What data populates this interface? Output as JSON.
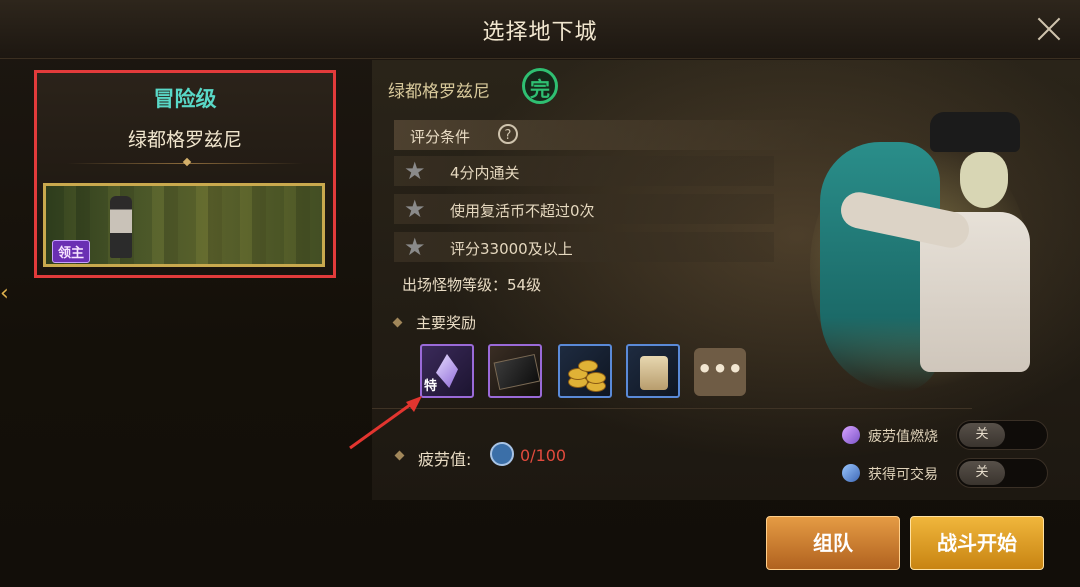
{
  "window": {
    "title": "选择地下城"
  },
  "dungeon_card": {
    "level": "冒险级",
    "name": "绿都格罗兹尼",
    "badge": "领主"
  },
  "detail": {
    "name": "绿都格罗兹尼",
    "complete_badge": "完",
    "score_header": "评分条件",
    "conditions": [
      "4分内通关",
      "使用复活币不超过0次",
      "评分33000及以上"
    ],
    "monster_level": "出场怪物等级：54级",
    "rewards_title": "主要奖励",
    "reward_items": [
      {
        "icon": "crystal-icon",
        "tag": "特"
      },
      {
        "icon": "ticket-icon"
      },
      {
        "icon": "gold-coins-icon"
      },
      {
        "icon": "scroll-icon"
      }
    ],
    "reward_more": "•••",
    "fatigue_label": "疲劳值:",
    "fatigue_value": "0/100"
  },
  "toggles": [
    {
      "label": "疲劳值燃烧",
      "state": "关"
    },
    {
      "label": "获得可交易",
      "state": "关"
    }
  ],
  "buttons": {
    "team": "组队",
    "fight": "战斗开始"
  },
  "colors": {
    "accent_teal": "#59d8c7",
    "highlight_red": "#e23b3b",
    "fatigue_red": "#e14a3d",
    "button_orange": "#e59b44",
    "button_gold": "#f0b63c"
  }
}
